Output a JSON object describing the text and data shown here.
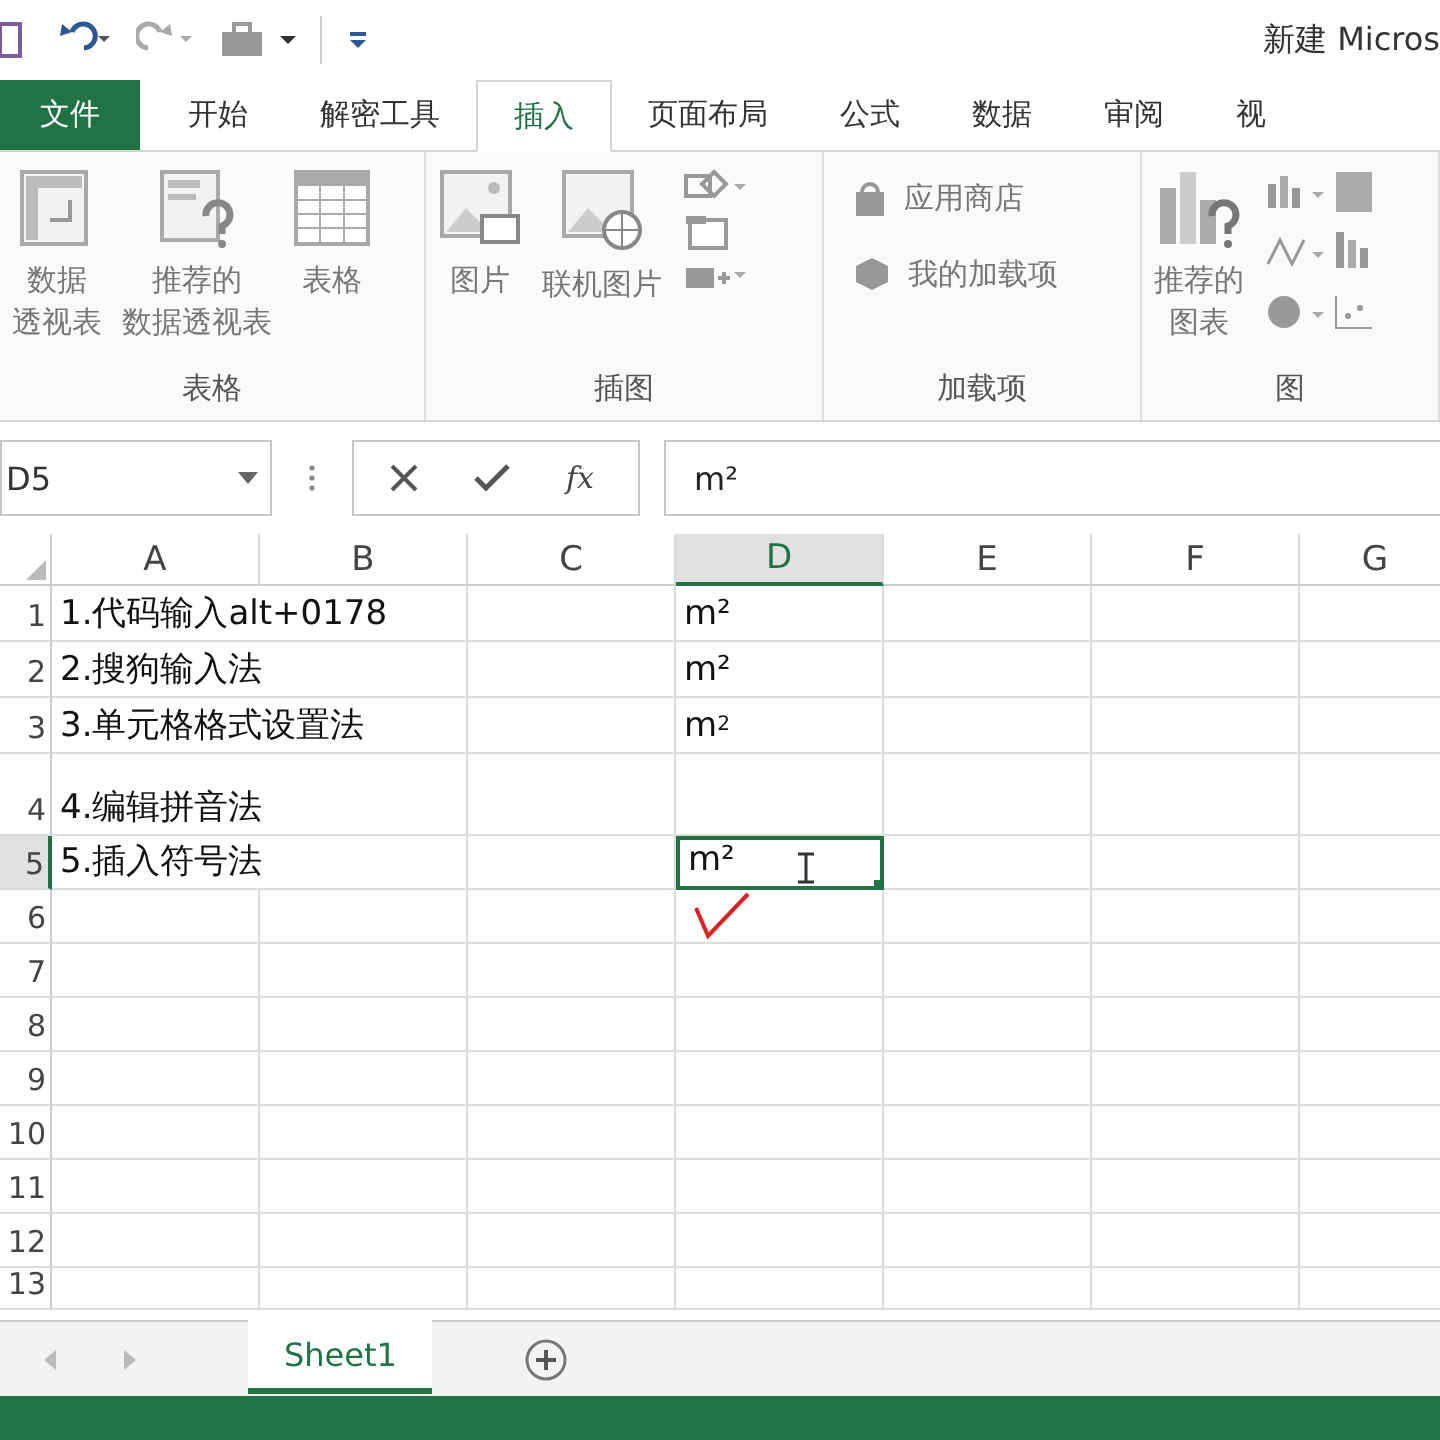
{
  "window": {
    "title": "新建 Micros"
  },
  "tabs": [
    {
      "label": "文件",
      "kind": "file",
      "selected": false
    },
    {
      "label": "开始",
      "kind": "tab",
      "selected": false
    },
    {
      "label": "解密工具",
      "kind": "tab",
      "selected": false
    },
    {
      "label": "插入",
      "kind": "tab",
      "selected": true
    },
    {
      "label": "页面布局",
      "kind": "tab",
      "selected": false
    },
    {
      "label": "公式",
      "kind": "tab",
      "selected": false
    },
    {
      "label": "数据",
      "kind": "tab",
      "selected": false
    },
    {
      "label": "审阅",
      "kind": "tab",
      "selected": false
    },
    {
      "label": "视",
      "kind": "tab",
      "selected": false
    }
  ],
  "ribbon": {
    "groups": [
      {
        "label": "表格",
        "items": [
          {
            "kind": "large",
            "lines": [
              "数据",
              "透视表"
            ]
          },
          {
            "kind": "large",
            "lines": [
              "推荐的",
              "数据透视表"
            ]
          },
          {
            "kind": "large",
            "lines": [
              "表格"
            ]
          }
        ]
      },
      {
        "label": "插图",
        "items": [
          {
            "kind": "large",
            "lines": [
              "图片"
            ]
          },
          {
            "kind": "large",
            "lines": [
              "联机图片"
            ]
          },
          {
            "kind": "stack"
          }
        ]
      },
      {
        "label": "加载项",
        "items": [
          {
            "kind": "small",
            "lines": [
              "应用商店"
            ]
          },
          {
            "kind": "small",
            "lines": [
              "我的加载项"
            ]
          }
        ]
      },
      {
        "label": "图",
        "items": [
          {
            "kind": "large",
            "lines": [
              "推荐的",
              "图表"
            ]
          },
          {
            "kind": "charts"
          }
        ]
      }
    ]
  },
  "formula_bar": {
    "name_box": "D5",
    "function_label": "fx",
    "formula": "m²"
  },
  "sheet": {
    "columns": [
      {
        "label": "A",
        "selected": false
      },
      {
        "label": "B",
        "selected": false
      },
      {
        "label": "C",
        "selected": false
      },
      {
        "label": "D",
        "selected": true
      },
      {
        "label": "E",
        "selected": false
      },
      {
        "label": "F",
        "selected": false
      },
      {
        "label": "G",
        "selected": false
      }
    ],
    "rows": [
      {
        "number": "1",
        "selected": false,
        "cells": [
          "1.代码输入alt+0178",
          "",
          "",
          "m²"
        ]
      },
      {
        "number": "2",
        "selected": false,
        "cells": [
          "2.搜狗输入法",
          "",
          "",
          "m²"
        ]
      },
      {
        "number": "3",
        "selected": false,
        "cells": [
          "3.单元格格式设置法",
          "",
          "",
          "m$^{2}$"
        ]
      },
      {
        "number": "4",
        "selected": false,
        "cells": [
          "4.编辑拼音法",
          "",
          "",
          ""
        ]
      },
      {
        "number": "5",
        "selected": true,
        "cells": [
          "5.插入符号法",
          "",
          "",
          "m²"
        ]
      },
      {
        "number": "6",
        "selected": false,
        "cells": []
      },
      {
        "number": "7",
        "selected": false,
        "cells": []
      },
      {
        "number": "8",
        "selected": false,
        "cells": []
      },
      {
        "number": "9",
        "selected": false,
        "cells": []
      },
      {
        "number": "10",
        "selected": false,
        "cells": []
      },
      {
        "number": "11",
        "selected": false,
        "cells": []
      },
      {
        "number": "12",
        "selected": false,
        "cells": []
      },
      {
        "number": "13",
        "selected": false,
        "cells": []
      }
    ]
  },
  "sheet_tabs": [
    {
      "label": "Sheet1",
      "selected": true
    }
  ]
}
